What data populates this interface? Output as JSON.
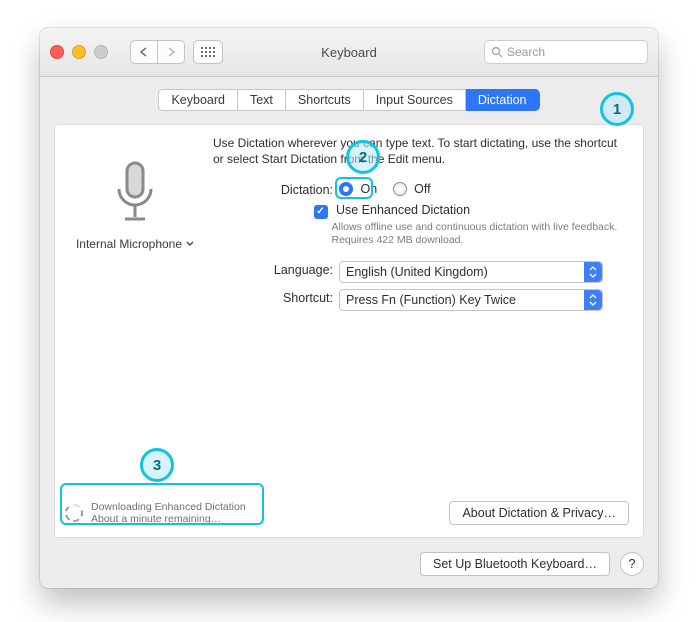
{
  "window": {
    "title": "Keyboard"
  },
  "search": {
    "placeholder": "Search"
  },
  "tabs": [
    {
      "label": "Keyboard"
    },
    {
      "label": "Text"
    },
    {
      "label": "Shortcuts"
    },
    {
      "label": "Input Sources"
    },
    {
      "label": "Dictation"
    }
  ],
  "instruction": "Use Dictation wherever you can type text. To start dictating, use the shortcut or select Start Dictation from the Edit menu.",
  "mic": {
    "label": "Internal Microphone"
  },
  "dictation": {
    "label": "Dictation:",
    "on": "On",
    "off": "Off",
    "enhanced_label": "Use Enhanced Dictation",
    "enhanced_hint": "Allows offline use and continuous dictation with live feedback. Requires 422 MB download."
  },
  "language": {
    "label": "Language:",
    "value": "English (United Kingdom)"
  },
  "shortcut": {
    "label": "Shortcut:",
    "value": "Press Fn (Function) Key Twice"
  },
  "download": {
    "line1": "Downloading Enhanced Dictation",
    "line2": "About a minute remaining…"
  },
  "buttons": {
    "about": "About Dictation & Privacy…",
    "bluetooth": "Set Up Bluetooth Keyboard…",
    "help": "?"
  }
}
